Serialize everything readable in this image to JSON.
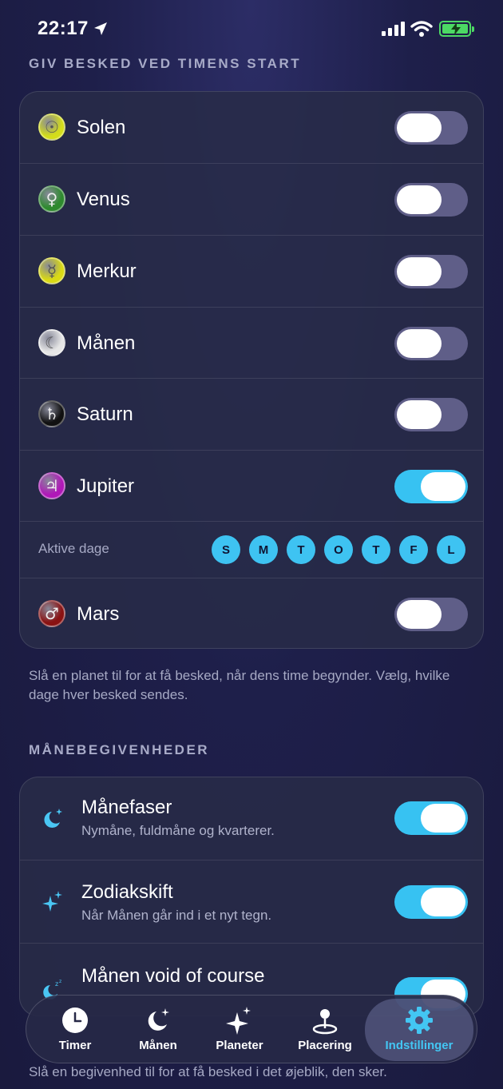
{
  "status": {
    "time": "22:17"
  },
  "notify_section": {
    "header": "GIV BESKED VED TIMENS START",
    "planets": [
      {
        "name": "Solen",
        "symbol": "☉",
        "color": "#d4dd1a",
        "on": false
      },
      {
        "name": "Venus",
        "symbol": "♀",
        "color": "#2e8a2e",
        "on": false
      },
      {
        "name": "Merkur",
        "symbol": "☿",
        "color": "#dada14",
        "on": false
      },
      {
        "name": "Månen",
        "symbol": "☾",
        "color": "#e6e6e6",
        "on": false
      },
      {
        "name": "Saturn",
        "symbol": "♄",
        "color": "#111111",
        "on": false
      },
      {
        "name": "Jupiter",
        "symbol": "♃",
        "color": "#b018b8",
        "on": true
      },
      {
        "name": "Mars",
        "symbol": "♂",
        "color": "#8a1212",
        "on": false
      }
    ],
    "active_days_label": "Aktive dage",
    "days": [
      "S",
      "M",
      "T",
      "O",
      "T",
      "F",
      "L"
    ],
    "footer": "Slå en planet til for at få besked, når dens time begynder. Vælg, hvilke dage hver besked sendes."
  },
  "moon_section": {
    "header": "MÅNEBEGIVENHEDER",
    "events": [
      {
        "title": "Månefaser",
        "subtitle": "Nymåne, fuldmåne og kvarterer.",
        "on": true
      },
      {
        "title": "Zodiakskift",
        "subtitle": "Når Månen går ind i et nyt tegn.",
        "on": true
      },
      {
        "title": "Månen void of course",
        "subtitle": "",
        "on": true
      }
    ],
    "footer": "Slå en begivenhed til for at få besked i det øjeblik, den sker."
  },
  "tabs": [
    {
      "label": "Timer",
      "icon": "clock-icon"
    },
    {
      "label": "Månen",
      "icon": "moon-stars-icon"
    },
    {
      "label": "Planeter",
      "icon": "sparkles-icon"
    },
    {
      "label": "Placering",
      "icon": "map-pin-icon"
    },
    {
      "label": "Indstillinger",
      "icon": "gear-icon",
      "active": true
    }
  ],
  "colors": {
    "accent": "#37c2f2",
    "toggle_off": "#5f5e88",
    "background": "#1e1f4a"
  }
}
